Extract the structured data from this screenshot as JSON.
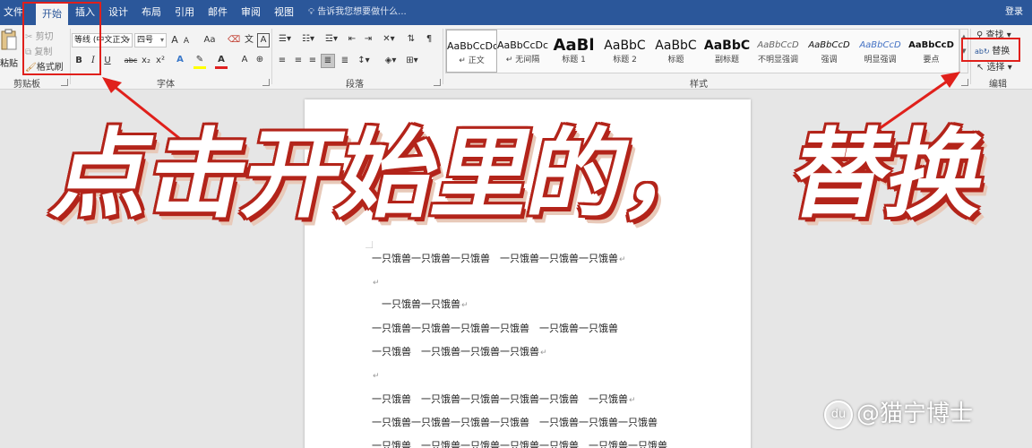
{
  "titlebar": {
    "tabs": [
      "文件",
      "开始",
      "插入",
      "设计",
      "布局",
      "引用",
      "邮件",
      "审阅",
      "视图"
    ],
    "tell_me": "告诉我您想要做什么...",
    "login": "登录"
  },
  "clipboard": {
    "paste": "粘贴",
    "cut": "剪切",
    "copy": "复制",
    "format_painter": "格式刷",
    "label": "剪贴板"
  },
  "font": {
    "font_name": "等线 (中文正文",
    "font_size": "四号",
    "grow": "A",
    "shrink": "A",
    "case": "Aa",
    "bold": "B",
    "italic": "I",
    "underline": "U",
    "strike": "abc",
    "subscript": "x₂",
    "superscript": "x²",
    "label": "字体"
  },
  "paragraph": {
    "label": "段落"
  },
  "styles": {
    "label": "样式",
    "items": [
      {
        "preview": "AaBbCcDc",
        "name": "正文",
        "selected": true
      },
      {
        "preview": "AaBbCcDc",
        "name": "无间隔"
      },
      {
        "preview": "AaBl",
        "name": "标题 1"
      },
      {
        "preview": "AaBbC",
        "name": "标题 2"
      },
      {
        "preview": "AaBbC",
        "name": "标题"
      },
      {
        "preview": "AaBbC",
        "name": "副标题"
      },
      {
        "preview": "AaBbCcD",
        "name": "不明显强调"
      },
      {
        "preview": "AaBbCcD",
        "name": "强调"
      },
      {
        "preview": "AaBbCcD",
        "name": "明显强调"
      },
      {
        "preview": "AaBbCcD",
        "name": "要点"
      }
    ]
  },
  "editing": {
    "find": "查找",
    "replace": "替换",
    "select": "选择",
    "label": "编辑"
  },
  "overlay": {
    "headline_left": "点击开始里的，",
    "headline_right": "替换"
  },
  "document": {
    "lines": [
      "一只饿兽一只饿兽一只饿兽　一只饿兽一只饿兽一只饿兽",
      "",
      "　一只饿兽一只饿兽",
      "一只饿兽一只饿兽一只饿兽一只饿兽　一只饿兽一只饿兽",
      "一只饿兽　一只饿兽一只饿兽一只饿兽",
      "",
      "一只饿兽　一只饿兽一只饿兽一只饿兽一只饿兽　一只饿兽",
      "一只饿兽一只饿兽一只饿兽一只饿兽　一只饿兽一只饿兽一只饿兽",
      "一只饿兽　一只饿兽一只饿兽一只饿兽一只饿兽　一只饿兽一只饿兽"
    ],
    "para_mark": "↵"
  },
  "watermark": {
    "logo": "du",
    "text": "@猫宁博士"
  },
  "colors": {
    "ribbon_blue": "#2b579a",
    "highlight_red": "#e0201b",
    "headline_outline": "#b3241a"
  }
}
